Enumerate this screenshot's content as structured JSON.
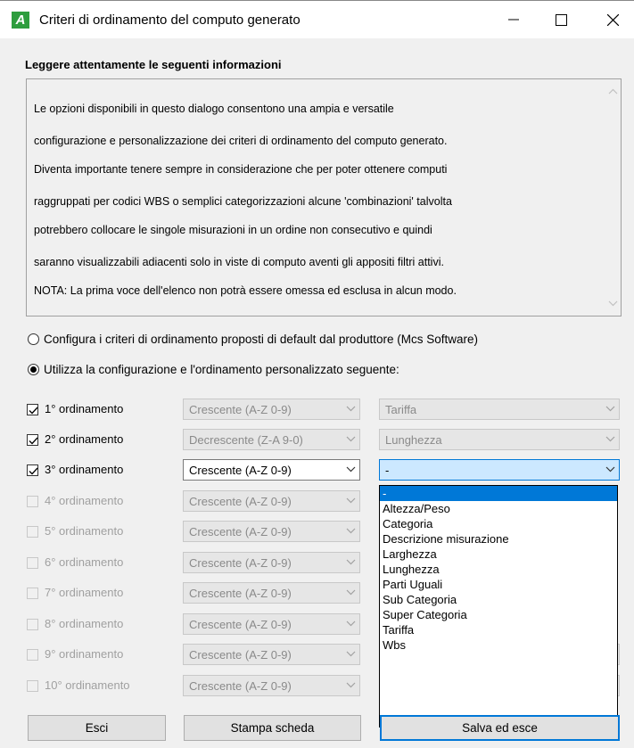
{
  "window": {
    "title": "Criteri di ordinamento del computo generato",
    "app_icon_letter": "A"
  },
  "info": {
    "heading": "Leggere attentamente le seguenti informazioni",
    "lines": [
      "Le opzioni disponibili in questo dialogo consentono una ampia e versatile",
      "configurazione e personalizzazione dei criteri di ordinamento del computo generato.",
      "Diventa importante tenere sempre in considerazione che per poter ottenere computi",
      "raggruppati per codici WBS o semplici categorizzazioni alcune 'combinazioni' talvolta",
      "potrebbero collocare le singole misurazioni in un ordine non consecutivo e quindi",
      "saranno visualizzabili adiacenti solo in viste di computo aventi gli appositi filtri attivi.",
      "NOTA: La prima voce dell'elenco non potrà essere omessa ed esclusa in alcun modo."
    ]
  },
  "options": {
    "default_label": "Configura i criteri di ordinamento proposti di default dal produttore (Mcs Software)",
    "custom_label": "Utilizza la configurazione e l'ordinamento personalizzato seguente:",
    "selected": "custom"
  },
  "sort_rows": [
    {
      "label": "1° ordinamento",
      "checked": true,
      "enabled": false,
      "order": "Crescente  (A-Z 0-9)",
      "field": "Tariffa"
    },
    {
      "label": "2° ordinamento",
      "checked": true,
      "enabled": false,
      "order": "Decrescente (Z-A 9-0)",
      "field": "Lunghezza"
    },
    {
      "label": "3° ordinamento",
      "checked": true,
      "enabled": true,
      "order": "Crescente  (A-Z 0-9)",
      "field": "-"
    },
    {
      "label": "4° ordinamento",
      "checked": false,
      "enabled": false,
      "order": "Crescente  (A-Z 0-9)",
      "field": ""
    },
    {
      "label": "5° ordinamento",
      "checked": false,
      "enabled": false,
      "order": "Crescente  (A-Z 0-9)",
      "field": ""
    },
    {
      "label": "6° ordinamento",
      "checked": false,
      "enabled": false,
      "order": "Crescente  (A-Z 0-9)",
      "field": ""
    },
    {
      "label": "7° ordinamento",
      "checked": false,
      "enabled": false,
      "order": "Crescente  (A-Z 0-9)",
      "field": ""
    },
    {
      "label": "8° ordinamento",
      "checked": false,
      "enabled": false,
      "order": "Crescente  (A-Z 0-9)",
      "field": ""
    },
    {
      "label": "9° ordinamento",
      "checked": false,
      "enabled": false,
      "order": "Crescente  (A-Z 0-9)",
      "field": "-"
    },
    {
      "label": "10° ordinamento",
      "checked": false,
      "enabled": false,
      "order": "Crescente  (A-Z 0-9)",
      "field": "-"
    }
  ],
  "dropdown": {
    "selected_index": 0,
    "items": [
      "-",
      "Altezza/Peso",
      "Categoria",
      "Descrizione misurazione",
      "Larghezza",
      "Lunghezza",
      "Parti Uguali",
      "Sub Categoria",
      "Super Categoria",
      "Tariffa",
      "Wbs"
    ]
  },
  "buttons": {
    "exit": "Esci",
    "print": "Stampa scheda",
    "save": "Salva ed esce"
  },
  "colors": {
    "accent": "#0078d7",
    "app_icon": "#2e9d3e",
    "disabled_text": "#a0a0a0"
  }
}
